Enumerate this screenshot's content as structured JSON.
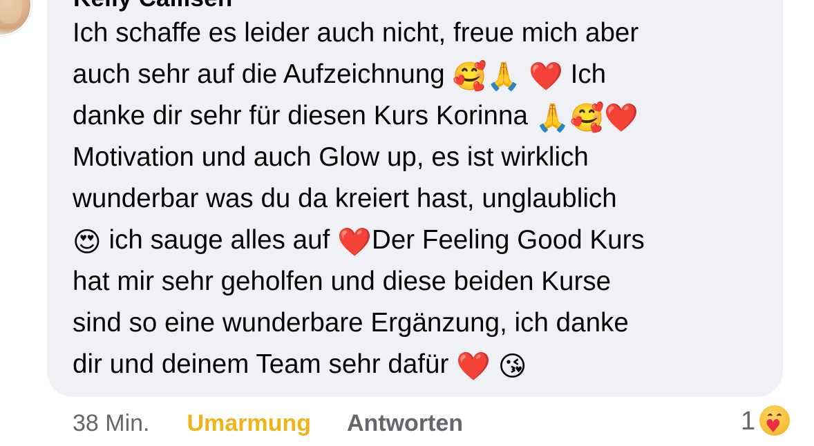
{
  "comment": {
    "author": "Kelly Callisen",
    "lines": [
      [
        {
          "t": "Ich schaffe es leider auch nicht, freue mich aber"
        }
      ],
      [
        {
          "t": "auch sehr auf die Aufzeichnung "
        },
        {
          "e": "🥰"
        },
        {
          "e": "🙏"
        },
        {
          "t": " "
        },
        {
          "e": "❤️"
        },
        {
          "t": " Ich"
        }
      ],
      [
        {
          "t": "danke dir sehr für diesen Kurs Korinna "
        },
        {
          "e": "🙏"
        },
        {
          "e": "🥰"
        },
        {
          "e": "❤️"
        }
      ],
      [
        {
          "t": "Motivation und auch Glow up, es ist wirklich"
        }
      ],
      [
        {
          "t": "wunderbar was du da kreiert hast, unglaublich"
        }
      ],
      [
        {
          "e": "😍"
        },
        {
          "t": " ich sauge alles auf "
        },
        {
          "e": "❤️"
        },
        {
          "t": "Der Feeling Good Kurs"
        }
      ],
      [
        {
          "t": "hat mir sehr geholfen und diese beiden Kurse"
        }
      ],
      [
        {
          "t": "sind so eine wunderbare Ergänzung, ich danke"
        }
      ],
      [
        {
          "t": "dir und deinem Team sehr dafür "
        },
        {
          "e": "❤️"
        },
        {
          "t": " "
        },
        {
          "e": "😘"
        }
      ]
    ]
  },
  "actions": {
    "timestamp": "38 Min.",
    "reaction_label": "Umarmung",
    "reply_label": "Antworten"
  },
  "reactions": {
    "count": "1",
    "icon": "care-hug-reaction-icon"
  },
  "colors": {
    "bubble": "#f0f1f4",
    "text": "#050505",
    "secondary": "#65676b",
    "care_reaction": "#f0b31a"
  }
}
